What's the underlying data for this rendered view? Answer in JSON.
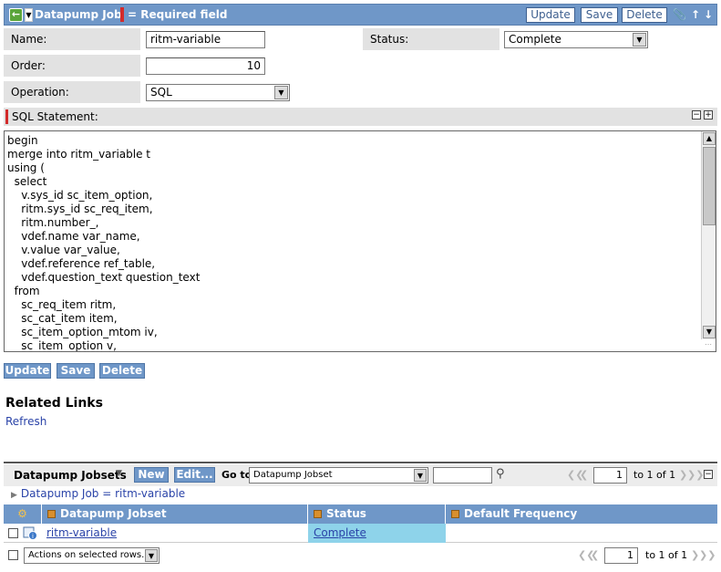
{
  "header": {
    "title": "Datapump Job",
    "required_note": "= Required field",
    "buttons": {
      "update": "Update",
      "save": "Save",
      "delete": "Delete"
    },
    "back_icon": "back-arrow-icon",
    "icons": [
      "attachment-icon",
      "up-arrow-icon",
      "down-arrow-icon"
    ]
  },
  "form": {
    "name": {
      "label": "Name:",
      "value": "ritm-variable"
    },
    "status": {
      "label": "Status:",
      "value": "Complete"
    },
    "order": {
      "label": "Order:",
      "value": "10"
    },
    "operation": {
      "label": "Operation:",
      "value": "SQL"
    },
    "sql": {
      "label": "SQL Statement:",
      "lines": [
        "begin",
        "merge into ritm_variable t",
        "using (",
        "  select",
        "    v.sys_id sc_item_option,",
        "    ritm.sys_id sc_req_item,",
        "    ritm.number_,",
        "    vdef.name var_name,",
        "    v.value var_value,",
        "    vdef.reference ref_table,",
        "    vdef.question_text question_text",
        "  from",
        "    sc_req_item ritm,",
        "    sc_cat_item item,",
        "    sc_item_option_mtom iv,",
        "    sc_item_option v,"
      ]
    }
  },
  "bottom_buttons": {
    "update": "Update",
    "save": "Save",
    "delete": "Delete"
  },
  "related_links": {
    "title": "Related Links",
    "refresh": "Refresh"
  },
  "related_list": {
    "title": "Datapump Jobsets",
    "new_label": "New",
    "edit_label": "Edit...",
    "goto_label": "Go to",
    "goto_value": "Datapump Jobset",
    "pager": {
      "page": "1",
      "range": "to 1 of 1"
    },
    "breadcrumb": "Datapump Job = ritm-variable",
    "columns": [
      "Datapump Jobset",
      "Status",
      "Default Frequency"
    ],
    "rows": [
      {
        "jobset": "ritm-variable",
        "status": "Complete",
        "frequency": ""
      }
    ],
    "actions_placeholder": "Actions on selected rows...",
    "footer_pager": {
      "page": "1",
      "range": "to 1 of 1"
    }
  },
  "colors": {
    "header": "#6f97c8",
    "mandatory": "#d22b2b",
    "label_bg": "#e2e2e2",
    "link": "#2a43a8",
    "status_cell": "#8ed3ea"
  }
}
